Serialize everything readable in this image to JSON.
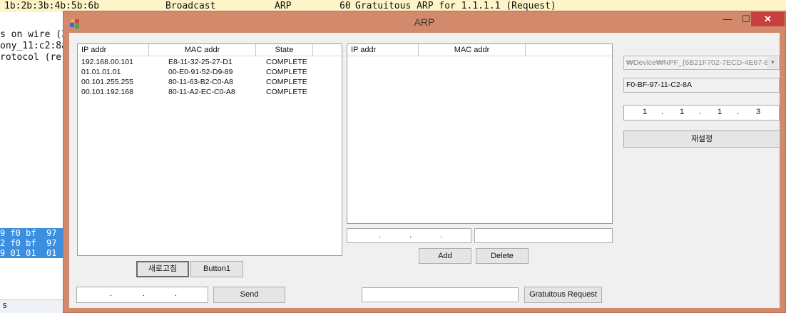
{
  "background_app": {
    "top_row": {
      "src_mac": "1b:2b:3b:4b:5b:6b",
      "dest": "Broadcast",
      "protocol": "ARP",
      "length": "60",
      "info": "Gratuitous ARP for 1.1.1.1 (Request)"
    },
    "detail_lines": [
      "s on wire (3",
      "ony_11:c2:8a",
      "rotocol (re"
    ],
    "hex_rows": [
      "9 f0 bf  97",
      "2 f0 bf  97",
      "9 01 01  01"
    ],
    "status_text": "s"
  },
  "window": {
    "title": "ARP",
    "controls": {
      "minimize": "—",
      "maximize": "☐",
      "close": "✕"
    }
  },
  "arp_table": {
    "columns": [
      "IP addr",
      "MAC addr",
      "State"
    ],
    "rows": [
      {
        "ip": "192.168.00.101",
        "mac": "E8-11-32-25-27-D1",
        "state": "COMPLETE"
      },
      {
        "ip": "01.01.01.01",
        "mac": "00-E0-91-52-D9-89",
        "state": "COMPLETE"
      },
      {
        "ip": "00.101.255.255",
        "mac": "80-11-63-B2-C0-A8",
        "state": "COMPLETE"
      },
      {
        "ip": "00.101.192.168",
        "mac": "80-11-A2-EC-C0-A8",
        "state": "COMPLETE"
      }
    ]
  },
  "proxy_table": {
    "columns": [
      "IP addr",
      "MAC addr"
    ]
  },
  "buttons": {
    "refresh": "새로고침",
    "button1": "Button1",
    "send": "Send",
    "add": "Add",
    "delete": "Delete",
    "gratuitous": "Gratuitous Request",
    "reset": "재설정"
  },
  "send_ip": {
    "sep": "."
  },
  "right_panel": {
    "adapter": "₩Device₩NPF_{6B21F702-7ECD-4E67-8",
    "mac": "F0-BF-97-11-C2-8A",
    "gratuitous_ip": [
      "1",
      "1",
      "1",
      "3"
    ],
    "sep": "."
  }
}
